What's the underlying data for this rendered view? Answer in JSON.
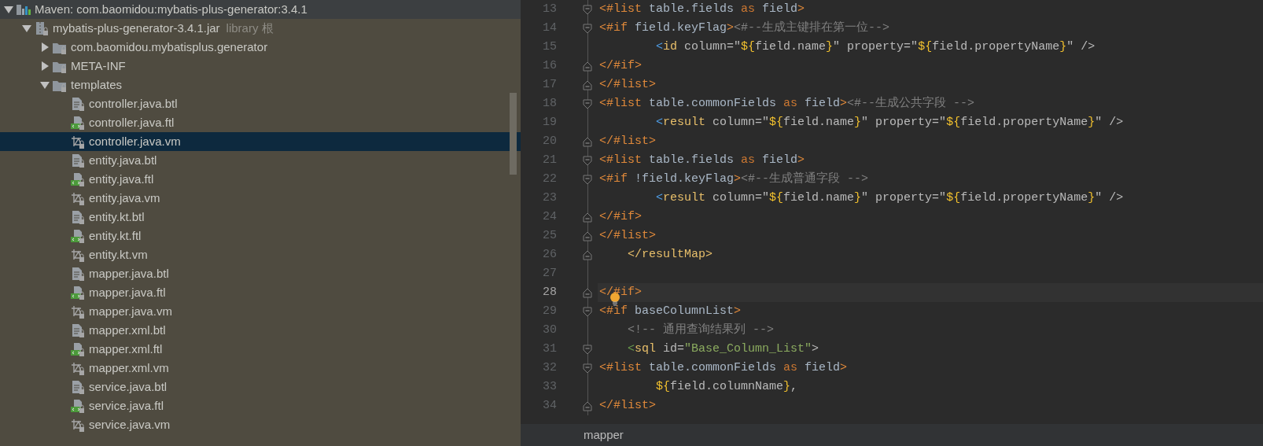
{
  "project_tree": {
    "items": [
      {
        "label": "Maven: com.baomidou:mybatis-plus-generator:3.4.1",
        "kind": "library",
        "expanded": true,
        "selected": false,
        "children": [
          {
            "label": "mybatis-plus-generator-3.4.1.jar",
            "suffix": "library 根",
            "kind": "jar",
            "expanded": true,
            "selected": false,
            "children": [
              {
                "label": "com.baomidou.mybatisplus.generator",
                "kind": "folder",
                "expanded": false,
                "selected": false
              },
              {
                "label": "META-INF",
                "kind": "folder",
                "expanded": false,
                "selected": false
              },
              {
                "label": "templates",
                "kind": "folder",
                "expanded": true,
                "selected": false,
                "children": [
                  {
                    "label": "controller.java.btl",
                    "kind": "btl",
                    "selected": false
                  },
                  {
                    "label": "controller.java.ftl",
                    "kind": "ftl",
                    "selected": false
                  },
                  {
                    "label": "controller.java.vm",
                    "kind": "vm",
                    "selected": true
                  },
                  {
                    "label": "entity.java.btl",
                    "kind": "btl",
                    "selected": false
                  },
                  {
                    "label": "entity.java.ftl",
                    "kind": "ftl",
                    "selected": false
                  },
                  {
                    "label": "entity.java.vm",
                    "kind": "vm",
                    "selected": false
                  },
                  {
                    "label": "entity.kt.btl",
                    "kind": "btl",
                    "selected": false
                  },
                  {
                    "label": "entity.kt.ftl",
                    "kind": "ftl",
                    "selected": false
                  },
                  {
                    "label": "entity.kt.vm",
                    "kind": "vm",
                    "selected": false
                  },
                  {
                    "label": "mapper.java.btl",
                    "kind": "btl",
                    "selected": false
                  },
                  {
                    "label": "mapper.java.ftl",
                    "kind": "ftl",
                    "selected": false
                  },
                  {
                    "label": "mapper.java.vm",
                    "kind": "vm",
                    "selected": false
                  },
                  {
                    "label": "mapper.xml.btl",
                    "kind": "btl",
                    "selected": false
                  },
                  {
                    "label": "mapper.xml.ftl",
                    "kind": "ftl",
                    "selected": false
                  },
                  {
                    "label": "mapper.xml.vm",
                    "kind": "vm",
                    "selected": false
                  },
                  {
                    "label": "service.java.btl",
                    "kind": "btl",
                    "selected": false
                  },
                  {
                    "label": "service.java.ftl",
                    "kind": "ftl",
                    "selected": false
                  },
                  {
                    "label": "service.java.vm",
                    "kind": "vm",
                    "selected": false
                  }
                ]
              }
            ]
          }
        ]
      }
    ]
  },
  "editor": {
    "lines": [
      {
        "number": "13",
        "kind": "foldstart",
        "current": false,
        "tokens": [
          {
            "kind": "ftl",
            "text": "<#list"
          },
          {
            "kind": "plain",
            "text": " table.fields "
          },
          {
            "kind": "keyword",
            "text": "as"
          },
          {
            "kind": "plain",
            "text": " field"
          },
          {
            "kind": "ftl",
            "text": ">"
          }
        ]
      },
      {
        "number": "14",
        "kind": "foldstart",
        "current": false,
        "tokens": [
          {
            "kind": "ftl",
            "text": "<#if"
          },
          {
            "kind": "plain",
            "text": " field.keyFlag"
          },
          {
            "kind": "ftl",
            "text": ">"
          },
          {
            "kind": "comment",
            "text": "<#--生成主键排在第一位-->"
          }
        ]
      },
      {
        "number": "15",
        "kind": "plain",
        "current": false,
        "tokens": [
          {
            "kind": "bracket",
            "text": "        <"
          },
          {
            "kind": "tag",
            "text": "id"
          },
          {
            "kind": "attr",
            "text": " column=\""
          },
          {
            "kind": "interp",
            "text": "${"
          },
          {
            "kind": "attr",
            "text": "field.name"
          },
          {
            "kind": "interp",
            "text": "}"
          },
          {
            "kind": "attr",
            "text": "\" property=\""
          },
          {
            "kind": "interp",
            "text": "${"
          },
          {
            "kind": "attr",
            "text": "field.propertyName"
          },
          {
            "kind": "interp",
            "text": "}"
          },
          {
            "kind": "attr",
            "text": "\" />"
          }
        ]
      },
      {
        "number": "16",
        "kind": "foldend",
        "current": false,
        "tokens": [
          {
            "kind": "ftl",
            "text": "</#if>"
          }
        ]
      },
      {
        "number": "17",
        "kind": "foldend",
        "current": false,
        "tokens": [
          {
            "kind": "ftl",
            "text": "</#list>"
          }
        ]
      },
      {
        "number": "18",
        "kind": "foldstart",
        "current": false,
        "tokens": [
          {
            "kind": "ftl",
            "text": "<#list"
          },
          {
            "kind": "plain",
            "text": " table.commonFields "
          },
          {
            "kind": "keyword",
            "text": "as"
          },
          {
            "kind": "plain",
            "text": " field"
          },
          {
            "kind": "ftl",
            "text": ">"
          },
          {
            "kind": "comment",
            "text": "<#--生成公共字段 -->"
          }
        ]
      },
      {
        "number": "19",
        "kind": "plain",
        "current": false,
        "tokens": [
          {
            "kind": "bracket",
            "text": "        <"
          },
          {
            "kind": "tag",
            "text": "result"
          },
          {
            "kind": "attr",
            "text": " column=\""
          },
          {
            "kind": "interp",
            "text": "${"
          },
          {
            "kind": "attr",
            "text": "field.name"
          },
          {
            "kind": "interp",
            "text": "}"
          },
          {
            "kind": "attr",
            "text": "\" property=\""
          },
          {
            "kind": "interp",
            "text": "${"
          },
          {
            "kind": "attr",
            "text": "field.propertyName"
          },
          {
            "kind": "interp",
            "text": "}"
          },
          {
            "kind": "attr",
            "text": "\" />"
          }
        ]
      },
      {
        "number": "20",
        "kind": "foldend",
        "current": false,
        "tokens": [
          {
            "kind": "ftl",
            "text": "</#list>"
          }
        ]
      },
      {
        "number": "21",
        "kind": "foldstart",
        "current": false,
        "tokens": [
          {
            "kind": "ftl",
            "text": "<#list"
          },
          {
            "kind": "plain",
            "text": " table.fields "
          },
          {
            "kind": "keyword",
            "text": "as"
          },
          {
            "kind": "plain",
            "text": " field"
          },
          {
            "kind": "ftl",
            "text": ">"
          }
        ]
      },
      {
        "number": "22",
        "kind": "foldstart",
        "current": false,
        "tokens": [
          {
            "kind": "ftl",
            "text": "<#if"
          },
          {
            "kind": "plain",
            "text": " !field.keyFlag"
          },
          {
            "kind": "ftl",
            "text": ">"
          },
          {
            "kind": "comment",
            "text": "<#--生成普通字段 -->"
          }
        ]
      },
      {
        "number": "23",
        "kind": "plain",
        "current": false,
        "tokens": [
          {
            "kind": "bracket",
            "text": "        <"
          },
          {
            "kind": "tag",
            "text": "result"
          },
          {
            "kind": "attr",
            "text": " column=\""
          },
          {
            "kind": "interp",
            "text": "${"
          },
          {
            "kind": "attr",
            "text": "field.name"
          },
          {
            "kind": "interp",
            "text": "}"
          },
          {
            "kind": "attr",
            "text": "\" property=\""
          },
          {
            "kind": "interp",
            "text": "${"
          },
          {
            "kind": "attr",
            "text": "field.propertyName"
          },
          {
            "kind": "interp",
            "text": "}"
          },
          {
            "kind": "attr",
            "text": "\" />"
          }
        ]
      },
      {
        "number": "24",
        "kind": "foldend",
        "current": false,
        "tokens": [
          {
            "kind": "ftl",
            "text": "</#if>"
          }
        ]
      },
      {
        "number": "25",
        "kind": "foldend",
        "current": false,
        "tokens": [
          {
            "kind": "ftl",
            "text": "</#list>"
          }
        ]
      },
      {
        "number": "26",
        "kind": "foldend",
        "current": false,
        "tokens": [
          {
            "kind": "tag",
            "text": "    </resultMap>"
          }
        ]
      },
      {
        "number": "27",
        "kind": "plain",
        "current": false
      },
      {
        "number": "28",
        "kind": "foldend",
        "current": true,
        "bulb": true,
        "tokens": [
          {
            "kind": "ftl",
            "text": "</#if>"
          }
        ]
      },
      {
        "number": "29",
        "kind": "foldstart",
        "current": false,
        "tokens": [
          {
            "kind": "ftl",
            "text": "<#if"
          },
          {
            "kind": "plain",
            "text": " baseColumnList"
          },
          {
            "kind": "ftl",
            "text": ">"
          }
        ]
      },
      {
        "number": "30",
        "kind": "plain",
        "current": false,
        "tokens": [
          {
            "kind": "comment",
            "text": "    <!-- 通用查询结果列 -->"
          }
        ]
      },
      {
        "number": "31",
        "kind": "foldstart",
        "current": false,
        "tokens": [
          {
            "kind": "sqlbracket",
            "text": "    <"
          },
          {
            "kind": "tag",
            "text": "sql"
          },
          {
            "kind": "attr",
            "text": " id="
          },
          {
            "kind": "string",
            "text": "\"Base_Column_List\""
          },
          {
            "kind": "attr",
            "text": ">"
          }
        ]
      },
      {
        "number": "32",
        "kind": "foldstart",
        "current": false,
        "tokens": [
          {
            "kind": "ftl",
            "text": "<#list"
          },
          {
            "kind": "plain",
            "text": " table.commonFields "
          },
          {
            "kind": "keyword",
            "text": "as"
          },
          {
            "kind": "plain",
            "text": " field"
          },
          {
            "kind": "ftl",
            "text": ">"
          }
        ]
      },
      {
        "number": "33",
        "kind": "plain",
        "current": false,
        "tokens": [
          {
            "kind": "interp",
            "text": "        ${"
          },
          {
            "kind": "attr",
            "text": "field.columnName"
          },
          {
            "kind": "interp",
            "text": "}"
          },
          {
            "kind": "attr",
            "text": ","
          }
        ]
      },
      {
        "number": "34",
        "kind": "foldend",
        "current": false,
        "tokens": [
          {
            "kind": "ftl",
            "text": "</#list>"
          }
        ]
      }
    ]
  },
  "breadcrumb": {
    "items": [
      "mapper"
    ]
  }
}
